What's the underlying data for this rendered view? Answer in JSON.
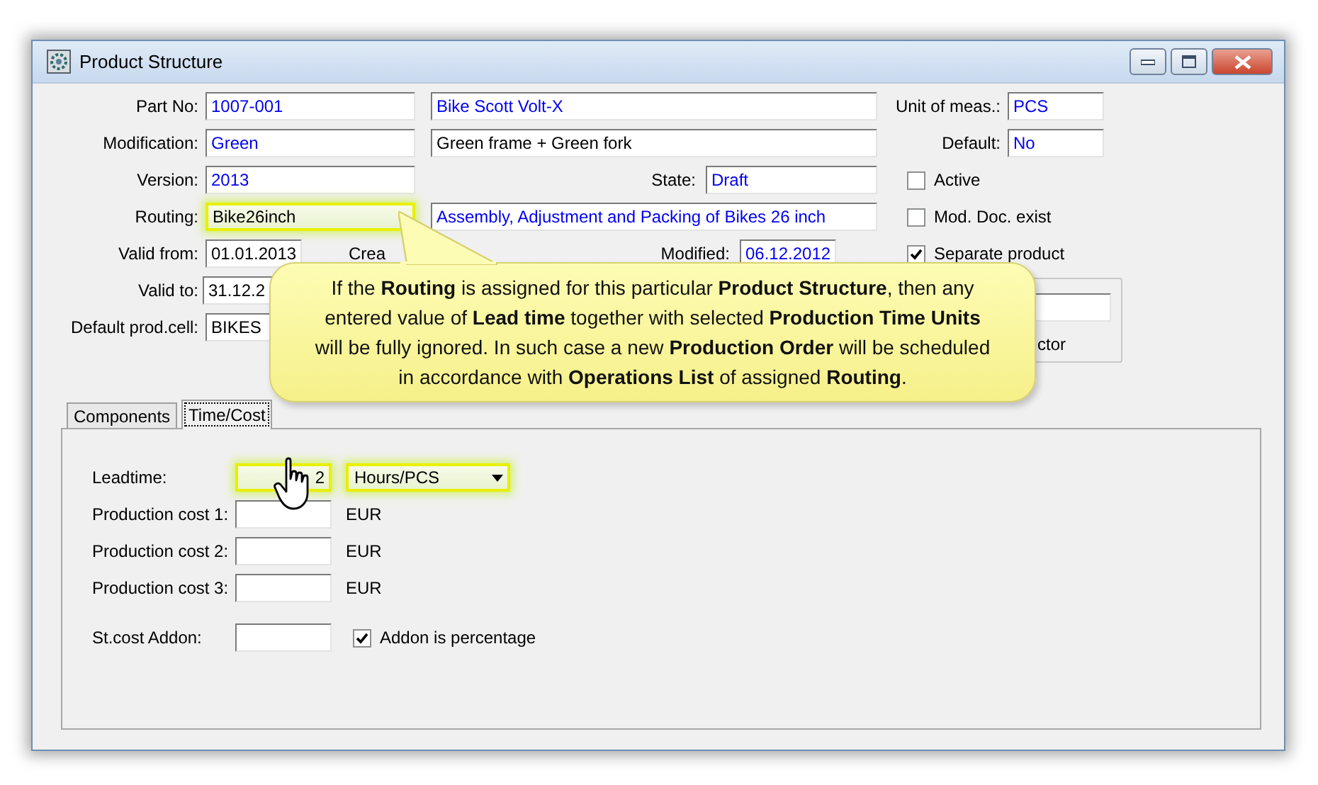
{
  "window": {
    "title": "Product Structure"
  },
  "fields": {
    "part_no": {
      "label": "Part No:",
      "value": "1007-001",
      "kind": "lookup"
    },
    "part_name": {
      "value": "Bike Scott Volt-X",
      "kind": "lookup"
    },
    "unit": {
      "label": "Unit of meas.:",
      "value": "PCS",
      "kind": "lookup"
    },
    "modification": {
      "label": "Modification:",
      "value": "Green",
      "kind": "lookup"
    },
    "modification_name": {
      "value": "Green frame + Green fork",
      "kind": "text"
    },
    "default": {
      "label": "Default:",
      "value": "No",
      "kind": "lookup"
    },
    "version": {
      "label": "Version:",
      "value": "2013",
      "kind": "lookup"
    },
    "state": {
      "label": "State:",
      "value": "Draft",
      "kind": "lookup"
    },
    "routing": {
      "label": "Routing:",
      "value": "Bike26inch",
      "kind": "text",
      "highlighted": true
    },
    "routing_name": {
      "value": "Assembly, Adjustment and Packing of Bikes 26 inch",
      "kind": "lookup"
    },
    "valid_from": {
      "label": "Valid from:",
      "value": "01.01.2013",
      "kind": "text"
    },
    "created": {
      "label": "Crea"
    },
    "modified": {
      "label": "Modified:",
      "value": "06.12.2012",
      "kind": "lookup"
    },
    "valid_to": {
      "label": "Valid to:",
      "value": "31.12.2",
      "kind": "text"
    },
    "default_prod_cell": {
      "label": "Default prod.cell:",
      "value": "BIKES",
      "kind": "text"
    }
  },
  "checkboxes": [
    {
      "label": "Active",
      "checked": false
    },
    {
      "label": "Mod. Doc. exist",
      "checked": false
    },
    {
      "label": "Separate product",
      "checked": true
    }
  ],
  "group_box": {
    "label": "ctor"
  },
  "tabs": [
    {
      "label": "Components",
      "selected": false
    },
    {
      "label": "Time/Cost",
      "selected": true
    }
  ],
  "time_cost": {
    "leadtime": {
      "label": "Leadtime:",
      "value": "2",
      "unit": "Hours/PCS",
      "highlighted": true
    },
    "costs": [
      {
        "label": "Production cost 1:",
        "currency": "EUR"
      },
      {
        "label": "Production cost 2:",
        "currency": "EUR"
      },
      {
        "label": "Production cost 3:",
        "currency": "EUR"
      }
    ],
    "addon": {
      "label": "St.cost Addon:",
      "checkbox": {
        "label": "Addon is percentage",
        "checked": true
      }
    }
  },
  "callout": {
    "text": "If the **Routing** is assigned for this particular **Product Structure**, then any entered value of **Lead time** together with selected **Production Time Units** will be fully ignored.  In such case a new **Production Order** will be scheduled in accordance with **Operations List** of assigned **Routing**."
  }
}
